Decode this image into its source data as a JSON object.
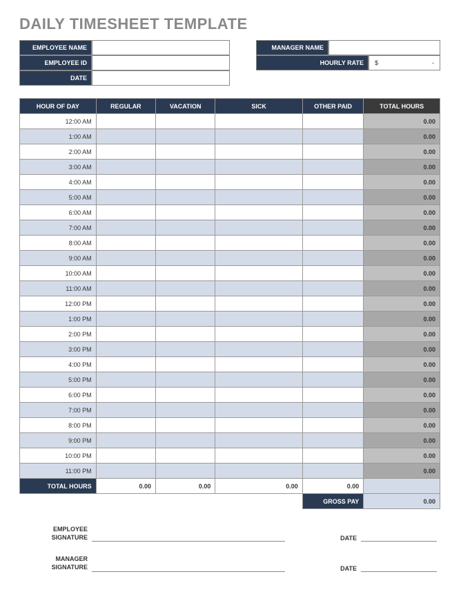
{
  "title": "DAILY TIMESHEET TEMPLATE",
  "info": {
    "employee_name_label": "EMPLOYEE NAME",
    "employee_id_label": "EMPLOYEE ID",
    "date_label": "DATE",
    "manager_name_label": "MANAGER NAME",
    "hourly_rate_label": "HOURLY RATE",
    "dollar_sign": "$",
    "dollar_dash": "-"
  },
  "table": {
    "headers": {
      "hour": "HOUR OF DAY",
      "regular": "REGULAR",
      "vacation": "VACATION",
      "sick": "SICK",
      "other": "OTHER PAID",
      "total": "TOTAL HOURS"
    },
    "rows": [
      {
        "hour": "12:00 AM",
        "total": "0.00"
      },
      {
        "hour": "1:00 AM",
        "total": "0.00"
      },
      {
        "hour": "2:00 AM",
        "total": "0.00"
      },
      {
        "hour": "3:00 AM",
        "total": "0.00"
      },
      {
        "hour": "4:00 AM",
        "total": "0.00"
      },
      {
        "hour": "5:00 AM",
        "total": "0.00"
      },
      {
        "hour": "6:00 AM",
        "total": "0.00"
      },
      {
        "hour": "7:00 AM",
        "total": "0.00"
      },
      {
        "hour": "8:00 AM",
        "total": "0.00"
      },
      {
        "hour": "9:00 AM",
        "total": "0.00"
      },
      {
        "hour": "10:00 AM",
        "total": "0.00"
      },
      {
        "hour": "11:00 AM",
        "total": "0.00"
      },
      {
        "hour": "12:00 PM",
        "total": "0.00"
      },
      {
        "hour": "1:00 PM",
        "total": "0.00"
      },
      {
        "hour": "2:00 PM",
        "total": "0.00"
      },
      {
        "hour": "3:00 PM",
        "total": "0.00"
      },
      {
        "hour": "4:00 PM",
        "total": "0.00"
      },
      {
        "hour": "5:00 PM",
        "total": "0.00"
      },
      {
        "hour": "6:00 PM",
        "total": "0.00"
      },
      {
        "hour": "7:00 PM",
        "total": "0.00"
      },
      {
        "hour": "8:00 PM",
        "total": "0.00"
      },
      {
        "hour": "9:00 PM",
        "total": "0.00"
      },
      {
        "hour": "10:00 PM",
        "total": "0.00"
      },
      {
        "hour": "11:00 PM",
        "total": "0.00"
      }
    ],
    "totals": {
      "label": "TOTAL HOURS",
      "regular": "0.00",
      "vacation": "0.00",
      "sick": "0.00",
      "other": "0.00",
      "total": ""
    },
    "gross_pay_label": "GROSS PAY",
    "gross_pay_value": "0.00"
  },
  "signatures": {
    "employee_label": "EMPLOYEE SIGNATURE",
    "manager_label": "MANAGER SIGNATURE",
    "date_label": "DATE"
  }
}
